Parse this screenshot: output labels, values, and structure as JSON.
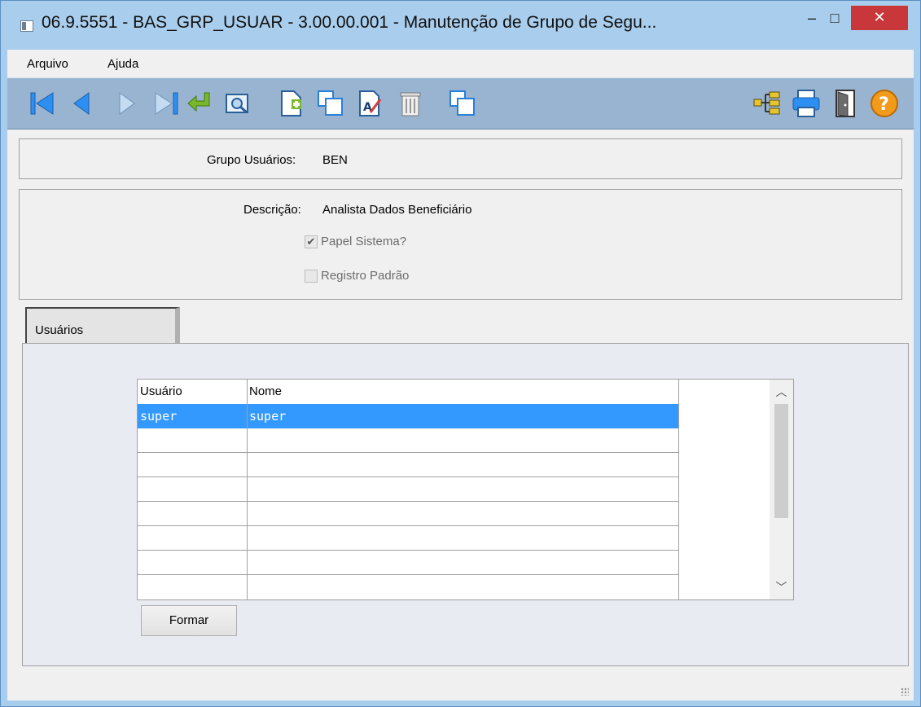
{
  "window": {
    "title": "06.9.5551 - BAS_GRP_USUAR - 3.00.00.001 - Manutenção de Grupo de Segu...",
    "minimize": "–",
    "maximize": "□",
    "close": "✕"
  },
  "menu": {
    "items": [
      "Arquivo",
      "Ajuda"
    ]
  },
  "toolbar": {
    "icons": [
      "first-record-icon",
      "previous-record-icon",
      "next-record-icon",
      "last-record-icon",
      "go-to-icon",
      "search-icon",
      "new-record-icon",
      "copy-icon",
      "edit-icon",
      "delete-icon",
      "duplicate-icon",
      "hierarchy-icon",
      "print-icon",
      "exit-icon",
      "help-icon"
    ],
    "colors": {
      "nav": "#2e8ff2",
      "goto": "#79b62c",
      "help": "#f29a1a"
    }
  },
  "form": {
    "grupo_label": "Grupo Usuários:",
    "grupo_value": "BEN",
    "descricao_label": "Descrição:",
    "descricao_value": "Analista Dados Beneficiário",
    "papel_sistema_label": "Papel Sistema?",
    "papel_sistema_checked": true,
    "registro_padrao_label": "Registro Padrão",
    "registro_padrao_checked": false
  },
  "tabs": {
    "active": "Usuários"
  },
  "grid": {
    "columns": [
      "Usuário",
      "Nome"
    ],
    "rows": [
      {
        "usuario": "super",
        "nome": "super",
        "selected": true
      }
    ],
    "selection_color": "#3399ff"
  },
  "buttons": {
    "formar": "Formar"
  }
}
